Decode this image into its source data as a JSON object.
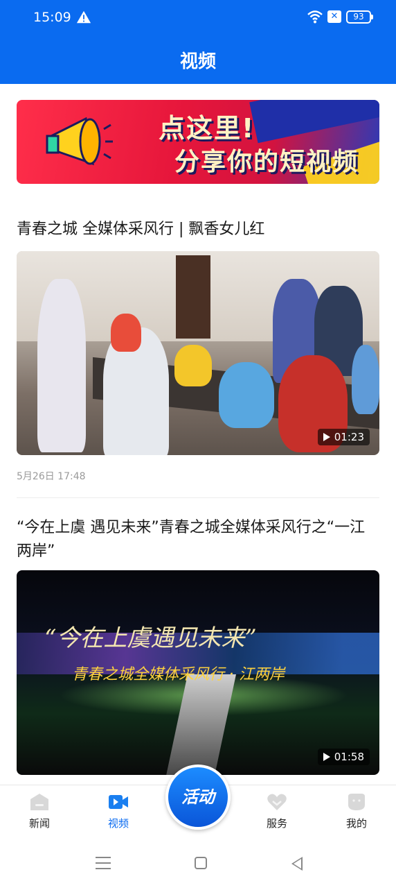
{
  "status_bar": {
    "time": "15:09",
    "battery": "93",
    "icons": [
      "warning-icon",
      "wifi-icon",
      "sim-off-icon",
      "battery-icon"
    ]
  },
  "header": {
    "title": "视频"
  },
  "banner": {
    "line1": "点这里!",
    "line2": "分享你的短视频"
  },
  "articles": [
    {
      "title": "青春之城 全媒体采风行 | 飘香女儿红",
      "duration": "01:23",
      "date": "5月26日 17:48"
    },
    {
      "title": "“今在上虞 遇见未来”青春之城全媒体采风行之“一江两岸”",
      "duration": "01:58",
      "overlay_text_1": "“今在上虞遇见未来”",
      "overlay_text_2": "青春之城全媒体采风行 · 江两岸"
    }
  ],
  "bottom_nav": {
    "items": [
      {
        "label": "新闻",
        "icon": "news-icon"
      },
      {
        "label": "视频",
        "icon": "video-icon",
        "active": true
      },
      {
        "label": "服务",
        "icon": "heart-icon"
      },
      {
        "label": "我的",
        "icon": "profile-icon"
      }
    ],
    "center_button": "活动"
  },
  "colors": {
    "brand_blue": "#0a6bf0",
    "text_dark": "#1a1a1a",
    "meta_gray": "#9a9a9a"
  }
}
